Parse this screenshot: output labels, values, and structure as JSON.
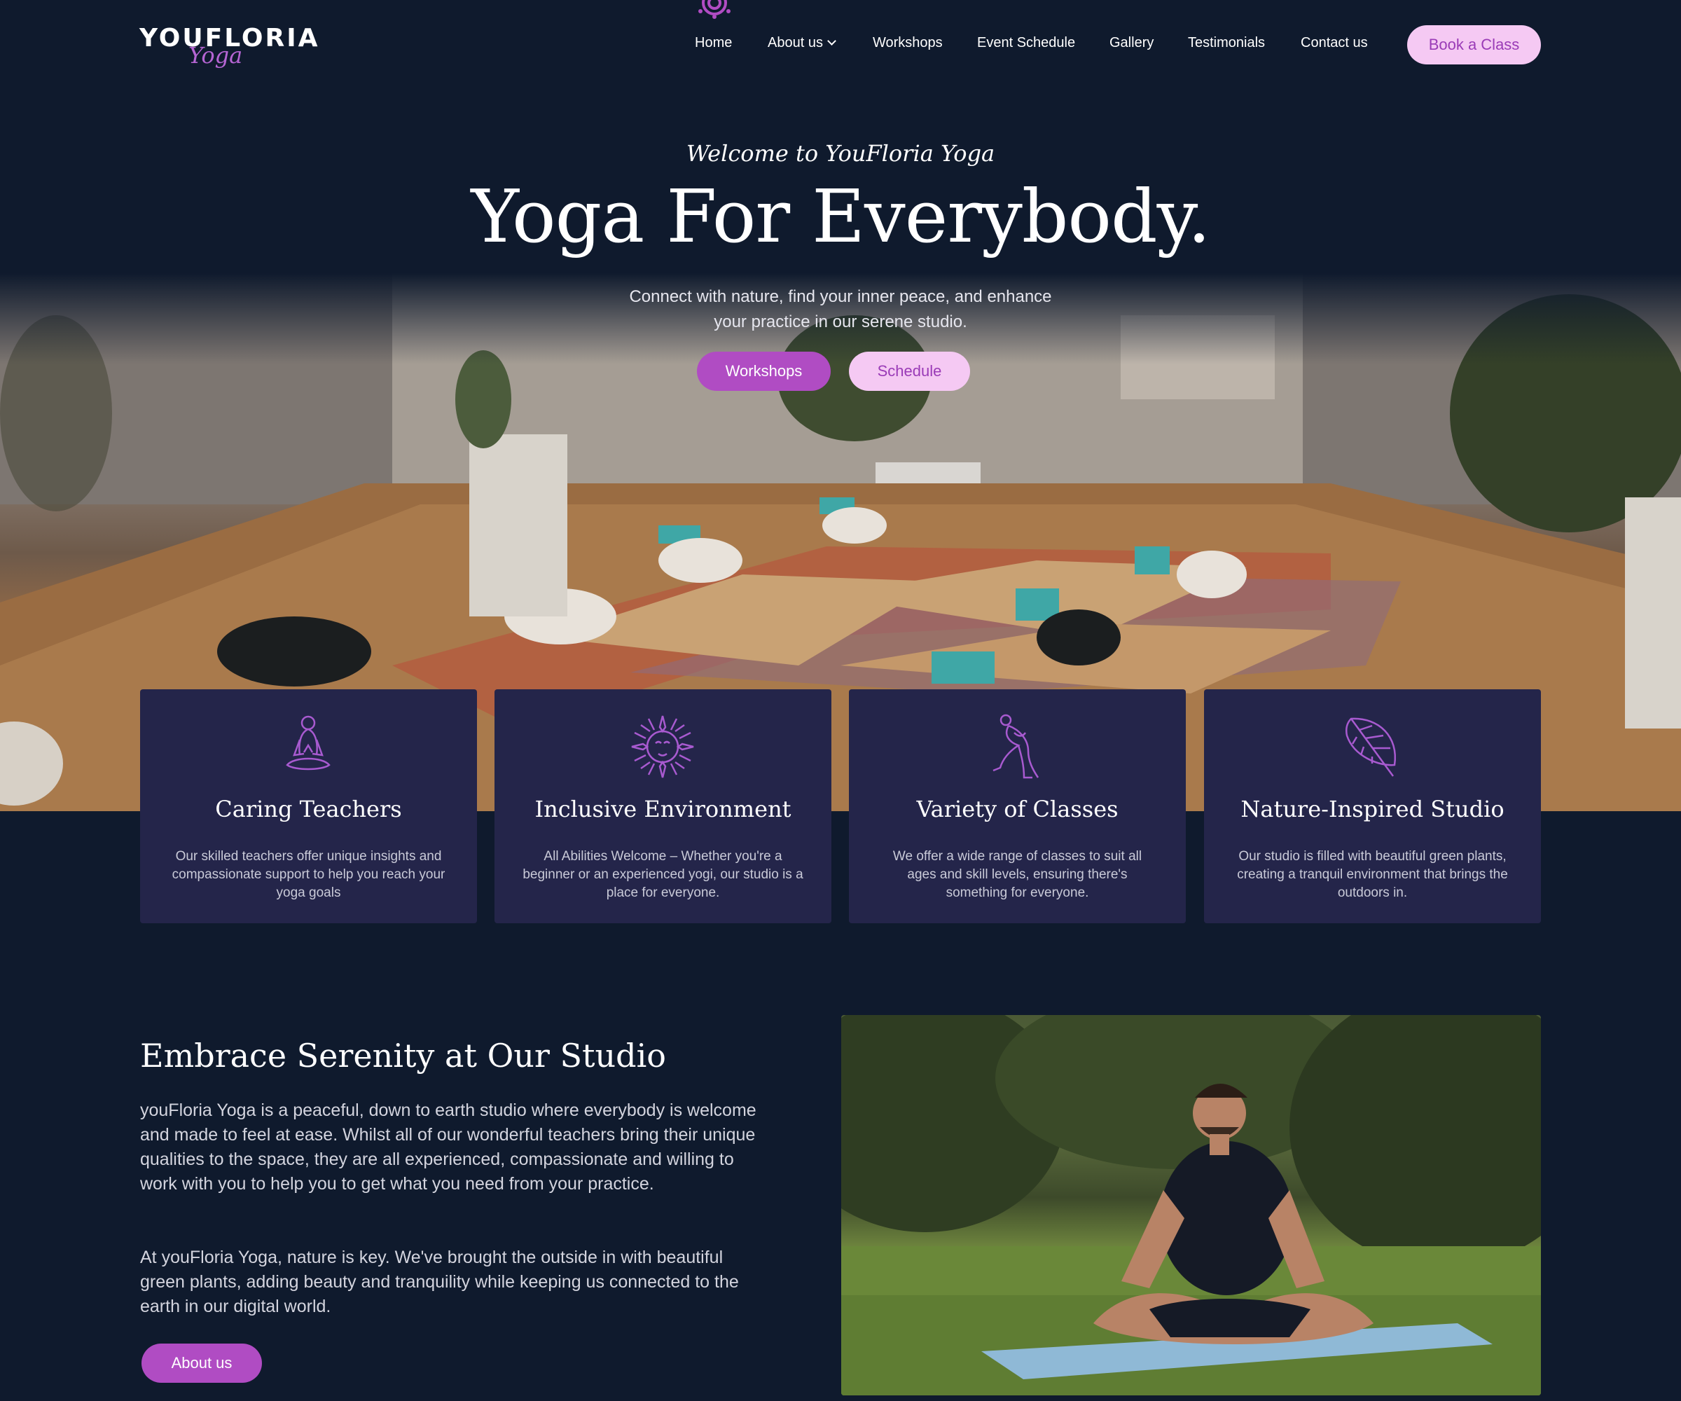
{
  "brand": {
    "name": "YOUFLORIA",
    "sub": "Yoga"
  },
  "nav": {
    "home": "Home",
    "about": "About us",
    "workshops": "Workshops",
    "schedule": "Event Schedule",
    "gallery": "Gallery",
    "testimonials": "Testimonials",
    "contact": "Contact us",
    "cta": "Book a Class"
  },
  "hero": {
    "kicker": "Welcome to YouFloria Yoga",
    "title": "Yoga For Everybody.",
    "subtitle_line1": "Connect with nature, find your inner peace, and enhance",
    "subtitle_line2": "your practice in our serene studio.",
    "btn_workshops": "Workshops",
    "btn_schedule": "Schedule"
  },
  "features": [
    {
      "icon": "meditating-person-icon",
      "title": "Caring Teachers",
      "text": "Our skilled teachers offer unique insights and compassionate support to help you reach your yoga goals"
    },
    {
      "icon": "sun-face-icon",
      "title": "Inclusive Environment",
      "text": "All Abilities Welcome – Whether you're a beginner or an experienced yogi, our studio is a place for everyone."
    },
    {
      "icon": "yoga-pose-icon",
      "title": "Variety of Classes",
      "text": "We offer a wide range of classes to suit all ages and skill levels, ensuring there's something for everyone."
    },
    {
      "icon": "monstera-leaf-icon",
      "title": "Nature-Inspired Studio",
      "text": "Our studio is filled with beautiful green plants, creating a tranquil environment that brings the outdoors in."
    }
  ],
  "about": {
    "title": "Embrace Serenity at Our Studio",
    "p1": "youFloria Yoga is a peaceful, down to earth studio where everybody is welcome and made to feel at ease. Whilst all of our wonderful teachers bring their unique qualities to the space, they are all experienced, compassionate and willing to work with you to help you to get what you need from your practice.",
    "p2": "At youFloria Yoga, nature is key. We've brought the outside in with beautiful green plants, adding beauty and tranquility while keeping us connected to the earth in our digital world.",
    "btn": "About us"
  },
  "colors": {
    "background": "#0f1a2d",
    "card": "#24254a",
    "accent": "#b04cc3",
    "accent_light": "#f5c9f3"
  }
}
